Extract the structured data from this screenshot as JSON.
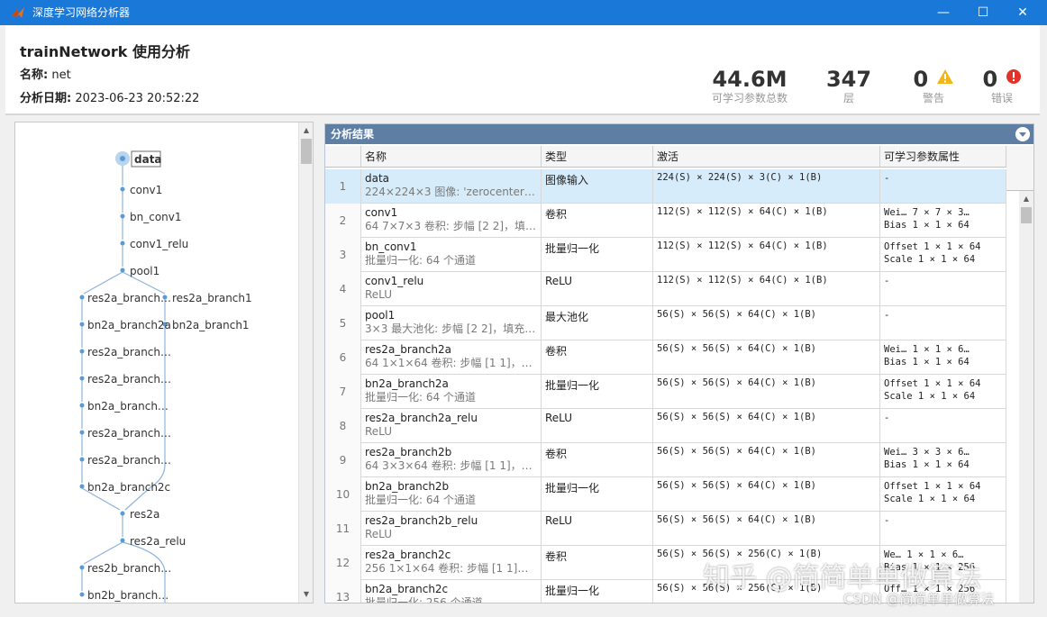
{
  "window": {
    "title": "深度学习网络分析器",
    "title_bar_color": "#1a78d8",
    "controls": {
      "minimize": "—",
      "maximize": "☐",
      "close": "✕"
    }
  },
  "header": {
    "title": "trainNetwork 使用分析",
    "name_label": "名称:",
    "name_value": "net",
    "date_label": "分析日期:",
    "date_value": "2023-06-23 20:52:22",
    "stats": [
      {
        "value": "44.6M",
        "label": "可学习参数总数"
      },
      {
        "value": "347",
        "label": "层"
      },
      {
        "value": "0",
        "label": "警告",
        "icon": "warning-icon"
      },
      {
        "value": "0",
        "label": "错误",
        "icon": "error-icon"
      }
    ]
  },
  "graph": {
    "nodes": [
      "data",
      "conv1",
      "bn_conv1",
      "conv1_relu",
      "pool1",
      "res2a_branch…",
      "res2a_branch1",
      "bn2a_branch2a",
      "bn2a_branch1",
      "res2a_branch…",
      "res2a_branch…",
      "bn2a_branch…",
      "res2a_branch…",
      "res2a_branch…",
      "bn2a_branch2c",
      "res2a",
      "res2a_relu",
      "res2b_branch…",
      "bn2b_branch…"
    ]
  },
  "results": {
    "header": "分析结果",
    "columns": [
      "名称",
      "类型",
      "激活",
      "可学习参数属性"
    ],
    "rows": [
      {
        "idx": "1",
        "name": "data",
        "desc": "224×224×3 图像: 'zerocenter' 归...",
        "type": "图像输入",
        "act": "224(S) × 224(S) × 3(C) × 1(B)",
        "prop1": "-",
        "prop2": ""
      },
      {
        "idx": "2",
        "name": "conv1",
        "desc": "64 7×7×3 卷积: 步幅 [2 2]，填充 [...",
        "type": "卷积",
        "act": "112(S) × 112(S) × 64(C) × 1(B)",
        "prop1": "Wei…  7 × 7 × 3…",
        "prop2": "Bias  1 × 1 × 64"
      },
      {
        "idx": "3",
        "name": "bn_conv1",
        "desc": "批量归一化: 64 个通道",
        "type": "批量归一化",
        "act": "112(S) × 112(S) × 64(C) × 1(B)",
        "prop1": "Offset 1 × 1 × 64",
        "prop2": "Scale  1 × 1 × 64"
      },
      {
        "idx": "4",
        "name": "conv1_relu",
        "desc": "ReLU",
        "type": "ReLU",
        "act": "112(S) × 112(S) × 64(C) × 1(B)",
        "prop1": "-",
        "prop2": ""
      },
      {
        "idx": "5",
        "name": "pool1",
        "desc": "3×3 最大池化: 步幅 [2 2]，填充 [0...",
        "type": "最大池化",
        "act": "56(S) × 56(S) × 64(C) × 1(B)",
        "prop1": "-",
        "prop2": ""
      },
      {
        "idx": "6",
        "name": "res2a_branch2a",
        "desc": "64 1×1×64 卷积: 步幅 [1 1]，填充...",
        "type": "卷积",
        "act": "56(S) × 56(S) × 64(C) × 1(B)",
        "prop1": "Wei…  1 × 1 × 6…",
        "prop2": "Bias  1 × 1 × 64"
      },
      {
        "idx": "7",
        "name": "bn2a_branch2a",
        "desc": "批量归一化: 64 个通道",
        "type": "批量归一化",
        "act": "56(S) × 56(S) × 64(C) × 1(B)",
        "prop1": "Offset 1 × 1 × 64",
        "prop2": "Scale  1 × 1 × 64"
      },
      {
        "idx": "8",
        "name": "res2a_branch2a_relu",
        "desc": "ReLU",
        "type": "ReLU",
        "act": "56(S) × 56(S) × 64(C) × 1(B)",
        "prop1": "-",
        "prop2": ""
      },
      {
        "idx": "9",
        "name": "res2a_branch2b",
        "desc": "64 3×3×64 卷积: 步幅 [1 1]，填充...",
        "type": "卷积",
        "act": "56(S) × 56(S) × 64(C) × 1(B)",
        "prop1": "Wei…  3 × 3 × 6…",
        "prop2": "Bias  1 × 1 × 64"
      },
      {
        "idx": "10",
        "name": "bn2a_branch2b",
        "desc": "批量归一化: 64 个通道",
        "type": "批量归一化",
        "act": "56(S) × 56(S) × 64(C) × 1(B)",
        "prop1": "Offset 1 × 1 × 64",
        "prop2": "Scale  1 × 1 × 64"
      },
      {
        "idx": "11",
        "name": "res2a_branch2b_relu",
        "desc": "ReLU",
        "type": "ReLU",
        "act": "56(S) × 56(S) × 64(C) × 1(B)",
        "prop1": "-",
        "prop2": ""
      },
      {
        "idx": "12",
        "name": "res2a_branch2c",
        "desc": "256 1×1×64 卷积: 步幅 [1 1]，填...",
        "type": "卷积",
        "act": "56(S) × 56(S) × 256(C) × 1(B)",
        "prop1": "We…  1 × 1 × 6…",
        "prop2": "Bias  1 × 1 × 256"
      },
      {
        "idx": "13",
        "name": "bn2a_branch2c",
        "desc": "批量归一化: 256 个通道",
        "type": "批量归一化",
        "act": "56(S) × 56(S) × 256(C) × 1(B)",
        "prop1": "Off… 1 × 1 × 256",
        "prop2": ""
      }
    ]
  },
  "watermarks": {
    "zhihu": "知乎 @简简单单做算法",
    "csdn": "CSDN @简简单单做算法"
  }
}
